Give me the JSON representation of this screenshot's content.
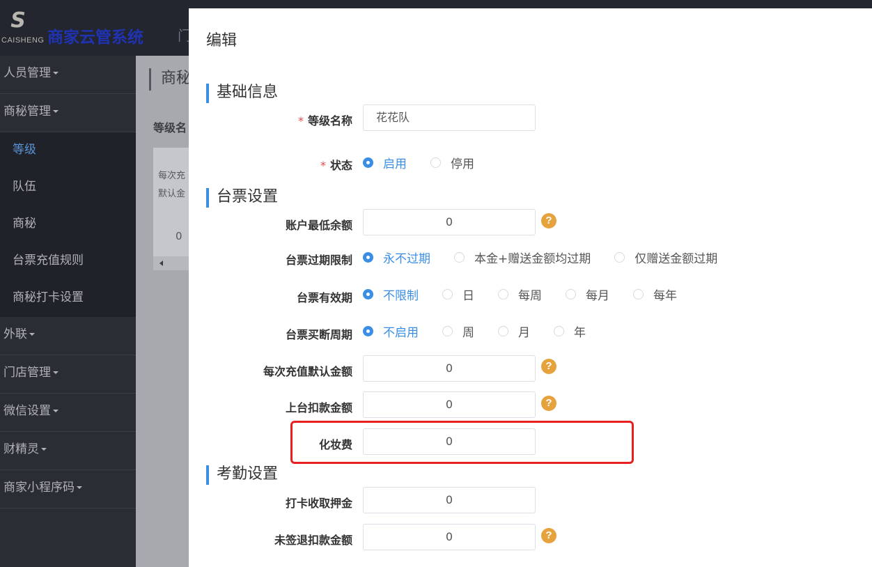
{
  "app": {
    "logo_text": "CAISHENG",
    "title": "商家云管系统",
    "top_nav_partial": "门"
  },
  "sidebar": {
    "groups": [
      {
        "label": "人员管理"
      },
      {
        "label": "商秘管理"
      }
    ],
    "sub_items": [
      {
        "label": "等级",
        "active": true
      },
      {
        "label": "队伍"
      },
      {
        "label": "商秘"
      },
      {
        "label": "台票充值规则"
      },
      {
        "label": "商秘打卡设置"
      }
    ],
    "groups_after": [
      {
        "label": "外联"
      },
      {
        "label": "门店管理"
      },
      {
        "label": "微信设置"
      },
      {
        "label": "财精灵"
      },
      {
        "label": "商家小程序码"
      }
    ]
  },
  "background_page": {
    "breadcrumb": "商秘",
    "sub_title": "等级名",
    "grid_header_1": "每次充",
    "grid_header_2": "默认金",
    "grid_cell": "0"
  },
  "modal": {
    "title": "编辑",
    "sections": {
      "basic": "基础信息",
      "ticket": "台票设置",
      "attendance": "考勤设置"
    },
    "fields": {
      "level_name": {
        "label": "等级名称",
        "value": "花花队"
      },
      "status": {
        "label": "状态",
        "options": [
          "启用",
          "停用"
        ],
        "selected": 0
      },
      "min_balance": {
        "label": "账户最低余额",
        "value": "0"
      },
      "expiry_limit": {
        "label": "台票过期限制",
        "options": [
          "永不过期",
          "本金+赠送金额均过期",
          "仅赠送金额过期"
        ],
        "selected": 0
      },
      "validity": {
        "label": "台票有效期",
        "options": [
          "不限制",
          "日",
          "每周",
          "每月",
          "每年"
        ],
        "selected": 0
      },
      "buyout_cycle": {
        "label": "台票买断周期",
        "options": [
          "不启用",
          "周",
          "月",
          "年"
        ],
        "selected": 0
      },
      "default_recharge": {
        "label": "每次充值默认金额",
        "value": "0"
      },
      "deduct_on_stage": {
        "label": "上台扣款金额",
        "value": "0"
      },
      "makeup_fee": {
        "label": "化妆费",
        "value": "0"
      },
      "checkin_deposit": {
        "label": "打卡收取押金",
        "value": "0"
      },
      "no_signout_deduct": {
        "label": "未签退扣款金额",
        "value": "0"
      }
    },
    "required_mark": "*",
    "help_symbol": "?"
  },
  "colors": {
    "accent": "#3a8ee6",
    "help": "#e6a23c",
    "required": "#e34b4b",
    "highlight": "#e82020"
  }
}
